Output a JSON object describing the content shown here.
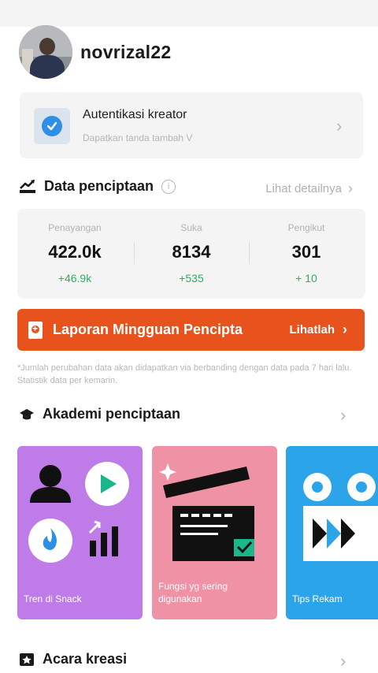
{
  "profile": {
    "username": "novrizal22"
  },
  "auth": {
    "title": "Autentikasi kreator",
    "subtitle": "Dapatkan tanda tambah V"
  },
  "data_section": {
    "title": "Data penciptaan",
    "detail_link": "Lihat detailnya"
  },
  "stats": [
    {
      "label": "Penayangan",
      "value": "422.0k",
      "change": "+46.9k"
    },
    {
      "label": "Suka",
      "value": "8134",
      "change": "+535"
    },
    {
      "label": "Pengikut",
      "value": "301",
      "change": "+ 10"
    }
  ],
  "report": {
    "title": "Laporan Mingguan Pencipta",
    "link": "Lihatlah"
  },
  "note": "*Jumlah perubahan data akan didapatkan via berbanding dengan data pada 7 hari lalu. Statistik data per kemarin.",
  "academy": {
    "title": "Akademi penciptaan",
    "cards": [
      {
        "label": "Tren di Snack"
      },
      {
        "label": "Fungsi yg sering digunakan"
      },
      {
        "label": "Tips Rekam"
      }
    ]
  },
  "events": {
    "title": "Acara kreasi"
  },
  "colors": {
    "accent_orange": "#e8521d",
    "positive_green": "#2fae62",
    "verify_blue": "#2e8fe6",
    "card_purple": "#bf7be8",
    "card_pink": "#f092a6",
    "card_blue": "#2ca4ea"
  },
  "icons": {
    "verify": "check-circle-icon",
    "data": "trend-chart-icon",
    "info": "info-icon",
    "report": "document-icon",
    "academy": "graduation-cap-icon",
    "events": "star-ticket-icon",
    "chevron": "chevron-right-icon"
  }
}
